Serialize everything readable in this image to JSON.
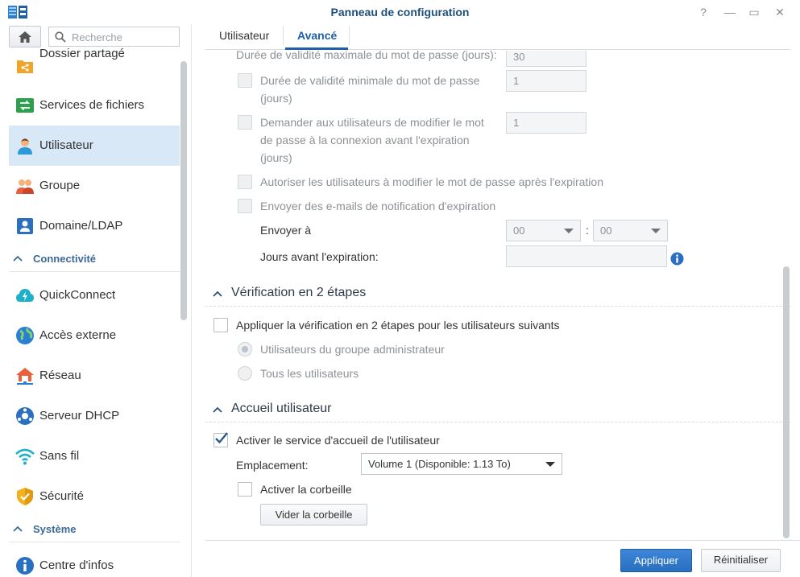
{
  "window": {
    "title": "Panneau de configuration",
    "controls": {
      "help": "?",
      "minimize": "—",
      "maximize": "▭",
      "close": "✕"
    }
  },
  "sidebar": {
    "search_placeholder": "Recherche",
    "items_top": [
      {
        "label": "Dossier partagé",
        "icon": "shared-folder-icon"
      },
      {
        "label": "Services de fichiers",
        "icon": "file-services-icon"
      },
      {
        "label": "Utilisateur",
        "icon": "user-icon",
        "active": true
      },
      {
        "label": "Groupe",
        "icon": "group-icon"
      },
      {
        "label": "Domaine/LDAP",
        "icon": "domain-ldap-icon"
      }
    ],
    "section_connectivity": "Connectivité",
    "items_connectivity": [
      {
        "label": "QuickConnect",
        "icon": "quickconnect-icon"
      },
      {
        "label": "Accès externe",
        "icon": "external-access-icon"
      },
      {
        "label": "Réseau",
        "icon": "network-icon"
      },
      {
        "label": "Serveur DHCP",
        "icon": "dhcp-server-icon"
      },
      {
        "label": "Sans fil",
        "icon": "wireless-icon"
      },
      {
        "label": "Sécurité",
        "icon": "security-icon"
      }
    ],
    "section_system": "Système",
    "items_system": [
      {
        "label": "Centre d'infos",
        "icon": "info-center-icon"
      }
    ]
  },
  "tabs": [
    {
      "label": "Utilisateur"
    },
    {
      "label": "Avancé",
      "active": true
    }
  ],
  "password": {
    "max_validity_label": "Durée de validité maximale du mot de passe (jours):",
    "max_validity_value": "30",
    "min_validity_label_1": "Durée de validité minimale du mot de passe",
    "min_validity_label_2": "(jours)",
    "min_validity_value": "1",
    "ask_change_label_1": "Demander aux utilisateurs de modifier le mot",
    "ask_change_label_2": "de passe à la connexion avant l'expiration",
    "ask_change_label_3": "(jours)",
    "ask_change_value": "1",
    "allow_after_expiry_label": "Autoriser les utilisateurs à modifier le mot de passe après l'expiration",
    "send_notification_label": "Envoyer des e-mails de notification d'expiration",
    "send_at_label": "Envoyer à",
    "send_hour": "00",
    "time_separator": ":",
    "send_minute": "00",
    "days_before_label": "Jours avant l'expiration:",
    "days_before_value": ""
  },
  "two_step": {
    "title": "Vérification en 2 étapes",
    "apply_label": "Appliquer la vérification en 2 étapes pour les utilisateurs suivants",
    "option_admins": "Utilisateurs du groupe administrateur",
    "option_all": "Tous les utilisateurs"
  },
  "user_home": {
    "title": "Accueil utilisateur",
    "enable_label": "Activer le service d'accueil de l'utilisateur",
    "location_label": "Emplacement:",
    "location_value": "Volume 1 (Disponible: 1.13 To)",
    "recycle_label": "Activer la corbeille",
    "empty_recycle_button": "Vider la corbeille"
  },
  "footer": {
    "apply": "Appliquer",
    "reset": "Réinitialiser"
  },
  "colors": {
    "accent": "#2a6fc0",
    "title": "#1d4f7a",
    "sidebar_active": "#d9e8f7"
  }
}
